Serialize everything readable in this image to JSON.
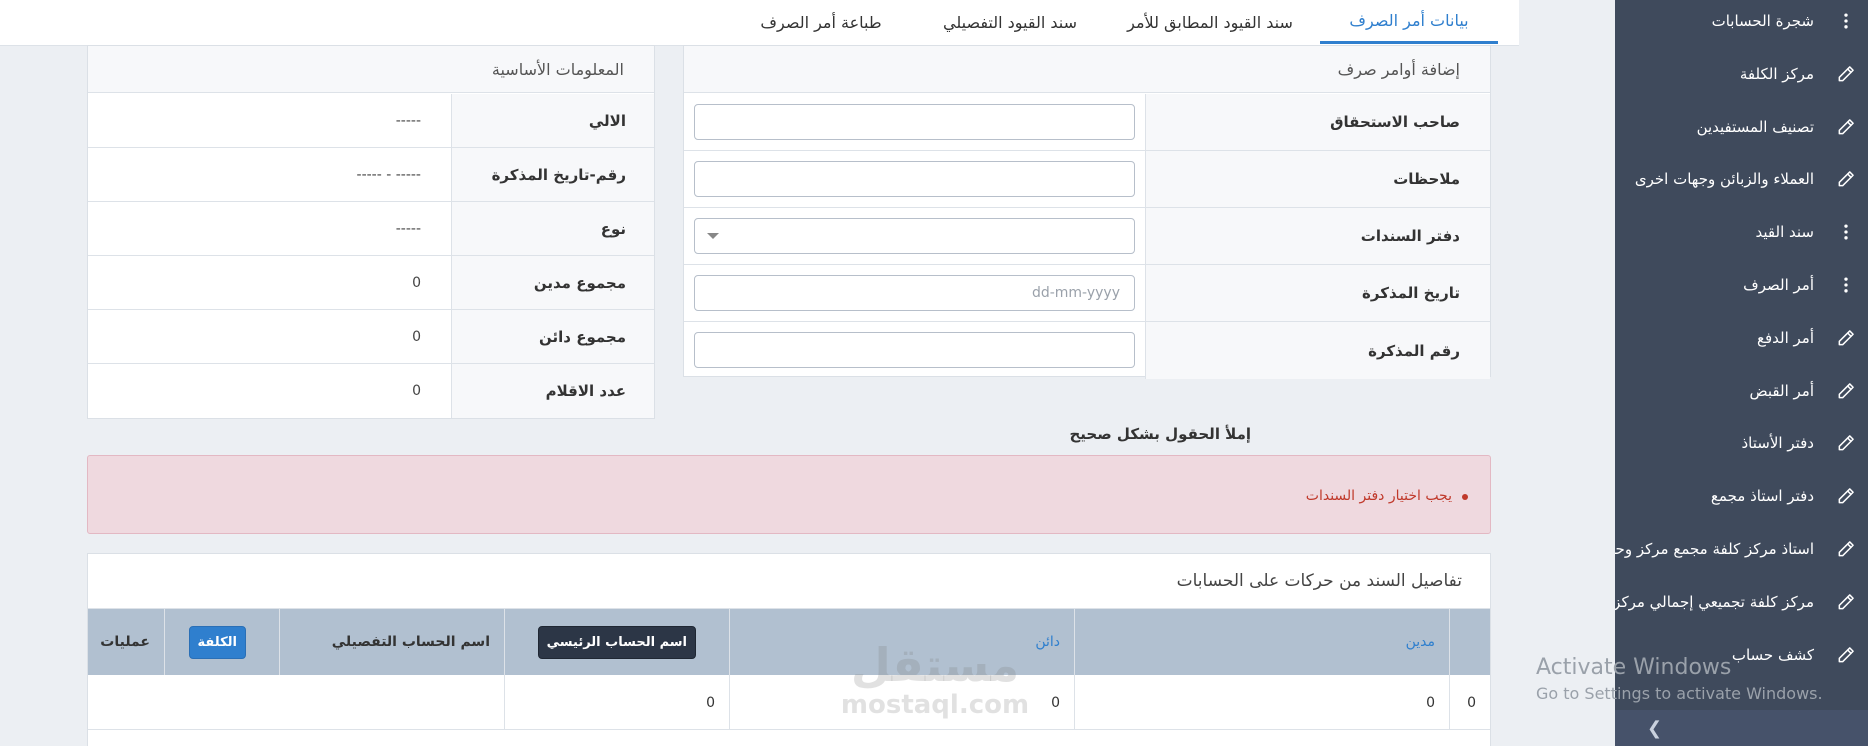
{
  "tabs": [
    {
      "label": "بيانات أمر الصرف",
      "active": true
    },
    {
      "label": "سند القيود المطابق للأمر",
      "active": false
    },
    {
      "label": "سند القيود التفصيلي",
      "active": false
    },
    {
      "label": "طباعة أمر الصرف",
      "active": false
    }
  ],
  "sidebar": {
    "items": [
      {
        "label": "شجرة الحسابات",
        "icon": "dots-icon"
      },
      {
        "label": "مركز الكلفة",
        "icon": "pencil-icon"
      },
      {
        "label": "تصنيف المستفيدين",
        "icon": "pencil-icon"
      },
      {
        "label": "العملاء والزبائن وجهات اخرى",
        "icon": "pencil-icon"
      },
      {
        "label": "سند القيد",
        "icon": "dots-icon"
      },
      {
        "label": "أمر الصرف",
        "icon": "dots-icon"
      },
      {
        "label": "أمر الدفع",
        "icon": "pencil-icon"
      },
      {
        "label": "أمر القبض",
        "icon": "pencil-icon"
      },
      {
        "label": "دفتر الأستاذ",
        "icon": "pencil-icon"
      },
      {
        "label": "دفتر استاذ مجمع",
        "icon": "pencil-icon"
      },
      {
        "label": "استاذ مركز كلفة مجمع مركز وحدة",
        "icon": "pencil-icon"
      },
      {
        "label": "مركز كلفة تجميعي إجمالي مركز",
        "icon": "pencil-icon"
      },
      {
        "label": "كشف حساب",
        "icon": "pencil-icon"
      }
    ],
    "collapse_icon": "chevron-right-icon"
  },
  "form": {
    "title": "إضافة أوامر صرف",
    "fields": [
      {
        "label": "صاحب الاستحقاق",
        "value": "",
        "placeholder": ""
      },
      {
        "label": "ملاحظات",
        "value": "",
        "placeholder": ""
      },
      {
        "label": "دفتر السندات",
        "value": "",
        "type": "select"
      },
      {
        "label": "تاريخ المذكرة",
        "value": "",
        "placeholder": "dd-mm-yyyy"
      },
      {
        "label": "رقم المذكرة",
        "value": "",
        "placeholder": ""
      }
    ]
  },
  "info": {
    "title": "المعلومات الأساسية",
    "rows": [
      {
        "label": "الالي",
        "value": "-----"
      },
      {
        "label": "رقم-تاريخ المذكرة",
        "value": "----- - -----"
      },
      {
        "label": "نوع",
        "value": "-----"
      },
      {
        "label": "مجموع مدين",
        "value": "0"
      },
      {
        "label": "مجموع دائن",
        "value": "0"
      },
      {
        "label": "عدد الاقلام",
        "value": "0"
      }
    ]
  },
  "hint": "إملأ الحقول بشكل صحيح",
  "alert": {
    "message": "يجب اختيار دفتر السندات"
  },
  "details": {
    "title": "تفاصيل السند من حركات على الحسابات",
    "headers": {
      "debit": "مدين",
      "credit": "دائن",
      "main_account": "اسم الحساب الرئيسي",
      "sub_account": "اسم الحساب التفصيلي",
      "cost": "الكلفة",
      "ops": "عمليات"
    },
    "row": {
      "index": "0",
      "debit": "0",
      "credit": "0",
      "main_account": "0"
    }
  },
  "watermark": {
    "ar": "مستقل",
    "en": "mostaql.com"
  },
  "activate": {
    "line1": "Activate Windows",
    "line2": "Go to Settings to activate Windows."
  }
}
